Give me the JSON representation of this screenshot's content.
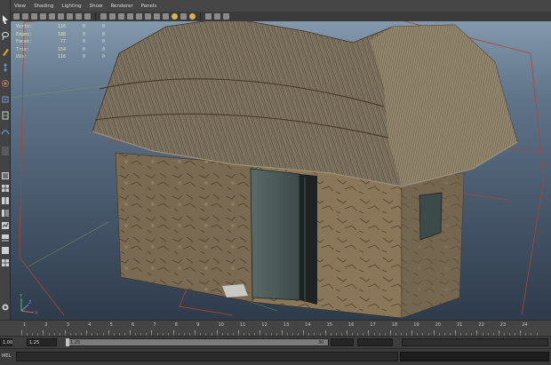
{
  "menus": [
    "View",
    "Shading",
    "Lighting",
    "Show",
    "Renderer",
    "Panels"
  ],
  "hud": {
    "rows": [
      {
        "label": "Verts:",
        "v1": "116",
        "v2": "0",
        "v3": "0"
      },
      {
        "label": "Edges:",
        "v1": "188",
        "v2": "0",
        "v3": "0"
      },
      {
        "label": "Faces:",
        "v1": "77",
        "v2": "0",
        "v3": "0"
      },
      {
        "label": "Tris:",
        "v1": "154",
        "v2": "0",
        "v3": "0"
      },
      {
        "label": "UVs:",
        "v1": "116",
        "v2": "0",
        "v3": "0"
      }
    ]
  },
  "axis": {
    "x": "X",
    "y": "Y",
    "z": "Z"
  },
  "timeline": {
    "ticks": [
      "1",
      "2",
      "3",
      "4",
      "5",
      "6",
      "7",
      "8",
      "9",
      "10",
      "11",
      "12",
      "13",
      "14",
      "15",
      "16",
      "17",
      "18",
      "19",
      "20",
      "21",
      "22",
      "23",
      "24"
    ]
  },
  "range": {
    "start": "1.00",
    "inner_start": "1.25",
    "inner_start2": "1.25",
    "end_marker": "30"
  },
  "command_line": {
    "label": "MEL"
  },
  "colors": {
    "viewport_top": "#8da3b6",
    "viewport_bottom": "#2e3b4b",
    "hud_text": "#dbe6a6",
    "wire_red": "#b0442e"
  }
}
